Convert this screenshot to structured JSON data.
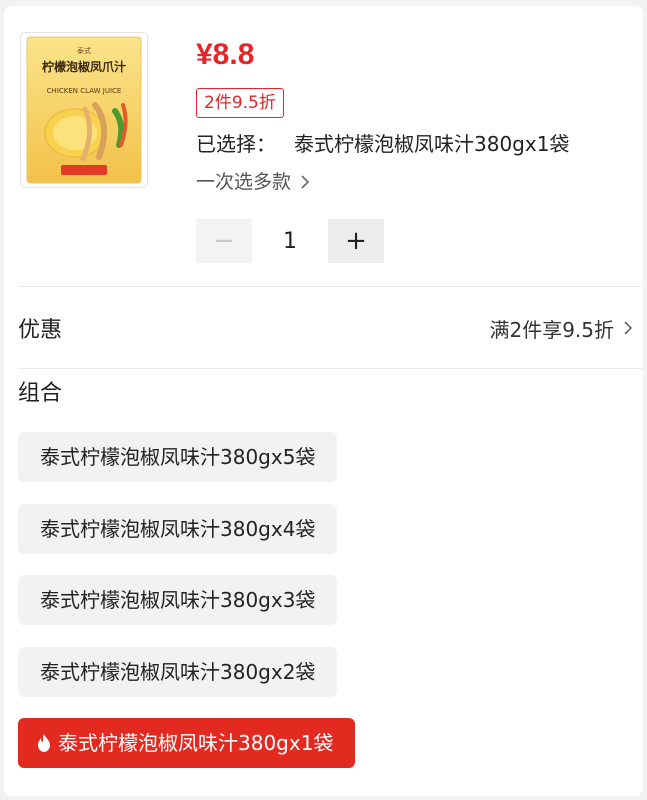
{
  "product": {
    "image_icon": "lemon-chicken-feet-sauce-package",
    "package_text": "柠檬泡椒凤爪汁",
    "package_subtext": "CHICKEN CLAW JUICE",
    "price": "¥8.8",
    "promo_tag": "2件9.5折",
    "selected_label": "已选择：",
    "selected_value": "泰式柠檬泡椒凤味汁380gx1袋",
    "multi_select_label": "一次选多款",
    "quantity": "1",
    "minus_label": "−",
    "plus_label": "+"
  },
  "discount": {
    "label": "优惠",
    "value": "满2件享9.5折"
  },
  "combo": {
    "title": "组合",
    "options": [
      {
        "label": "泰式柠檬泡椒凤味汁380gx5袋",
        "selected": false
      },
      {
        "label": "泰式柠檬泡椒凤味汁380gx4袋",
        "selected": false
      },
      {
        "label": "泰式柠檬泡椒凤味汁380gx3袋",
        "selected": false
      },
      {
        "label": "泰式柠檬泡椒凤味汁380gx2袋",
        "selected": false
      },
      {
        "label": "泰式柠檬泡椒凤味汁380gx1袋",
        "selected": true
      }
    ]
  },
  "colors": {
    "accent": "#e4262b",
    "selected_bg": "#e32a20",
    "option_bg": "#f2f2f2"
  }
}
